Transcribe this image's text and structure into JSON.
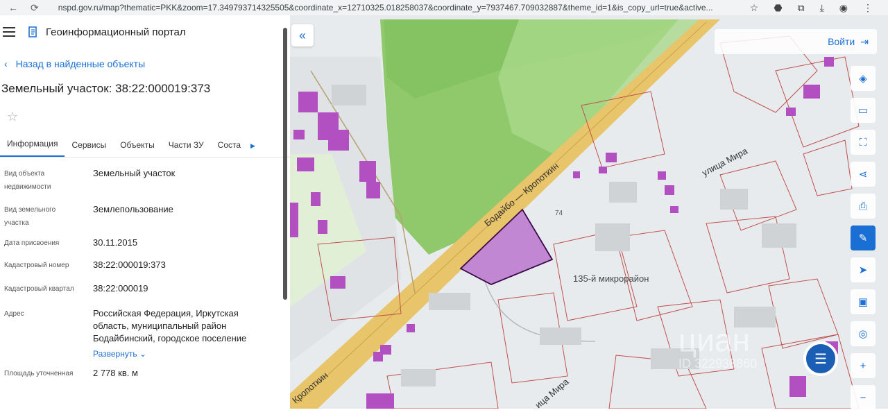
{
  "browser": {
    "url": "nspd.gov.ru/map?thematic=PKK&zoom=17.349793714325505&coordinate_x=12710325.018258037&coordinate_y=7937467.709032887&theme_id=1&is_copy_url=true&active..."
  },
  "header": {
    "portal_title": "Геоинформационный портал"
  },
  "back_link": "Назад в найденные объекты",
  "parcel_title": "Земельный участок: 38:22:000019:373",
  "tabs": [
    {
      "label": "Информация"
    },
    {
      "label": "Сервисы"
    },
    {
      "label": "Объекты"
    },
    {
      "label": "Части ЗУ"
    },
    {
      "label": "Соста"
    }
  ],
  "info": {
    "object_type_label_1": "Вид объекта",
    "object_type_label_2": "недвижимости",
    "object_type_value": "Земельный участок",
    "land_use_label_1": "Вид земельного",
    "land_use_label_2": "участка",
    "land_use_value": "Землепользование",
    "date_label": "Дата присвоения",
    "date_value": "30.11.2015",
    "cad_number_label": "Кадастровый номер",
    "cad_number_value": "38:22:000019:373",
    "cad_quarter_label": "Кадастровый квартал",
    "cad_quarter_value": "38:22:000019",
    "address_label": "Адрес",
    "address_line1": "Российская Федерация, Иркутская",
    "address_line2": "область, муниципальный район",
    "address_line3": "Бодайбинский, городское поселение",
    "expand_label": "Развернуть",
    "area_label": "Площадь уточненная",
    "area_value": "2 778 кв. м"
  },
  "map": {
    "login_label": "Войти",
    "road_label_1": "Бодайбо — Кропоткин",
    "road_label_2": "Кропоткин",
    "street_label_1": "улица Мира",
    "street_label_2": "ица Мира",
    "district_label": "135-й микрорайон",
    "house_number": "74",
    "watermark": "циан",
    "watermark_id": "ID 322938860"
  },
  "colors": {
    "accent": "#1a6fd4",
    "parcel_fill": "#b565c8",
    "forest": "#8fc96b",
    "road": "#e8c46a"
  }
}
